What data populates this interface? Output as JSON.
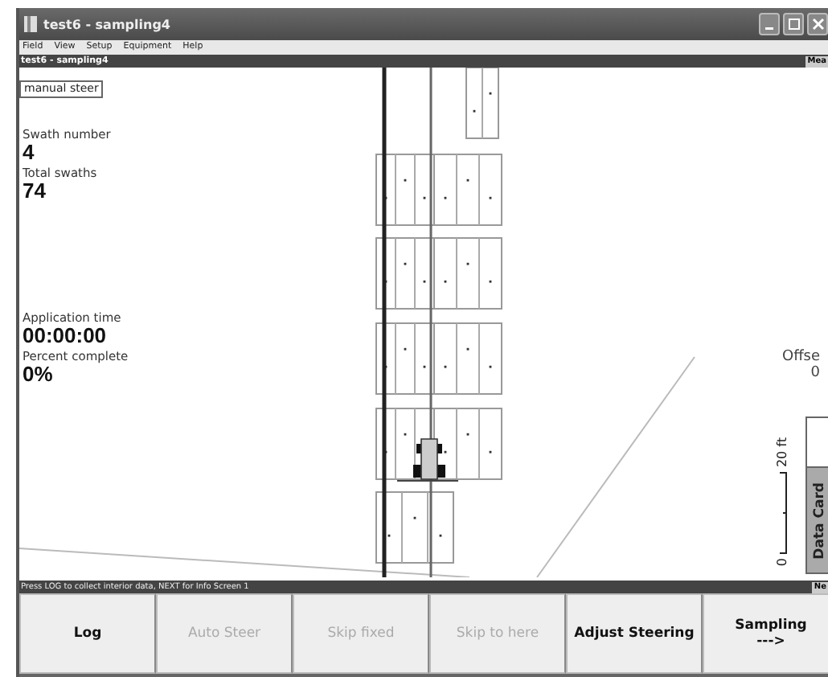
{
  "window": {
    "title": "test6 - sampling4"
  },
  "menu": [
    "Field",
    "View",
    "Setup",
    "Equipment",
    "Help"
  ],
  "header": {
    "title": "test6 - sampling4",
    "right": "Mea"
  },
  "mode": "manual steer",
  "stat_groups": [
    [
      {
        "label": "Swath number",
        "value": "4"
      },
      {
        "label": "Total swaths",
        "value": "74"
      }
    ],
    [
      {
        "label": "Application time",
        "value": "00:00:00"
      },
      {
        "label": "Percent complete",
        "value": "0%"
      }
    ]
  ],
  "offset": {
    "label": "Offse",
    "value": "0"
  },
  "data_card": {
    "label": "Data Card"
  },
  "scale": {
    "start": "0",
    "end": "20 ft"
  },
  "status_bar": {
    "message": "Press LOG to collect interior data, NEXT for Info Screen 1",
    "right": "Ne"
  },
  "buttons": [
    {
      "label": "Log",
      "disabled": false
    },
    {
      "label": "Auto Steer",
      "disabled": true
    },
    {
      "label": "Skip fixed",
      "disabled": true
    },
    {
      "label": "Skip to here",
      "disabled": true
    },
    {
      "label": "Adjust Steering",
      "disabled": false
    },
    {
      "label": "Sampling\n--->",
      "disabled": false
    }
  ]
}
